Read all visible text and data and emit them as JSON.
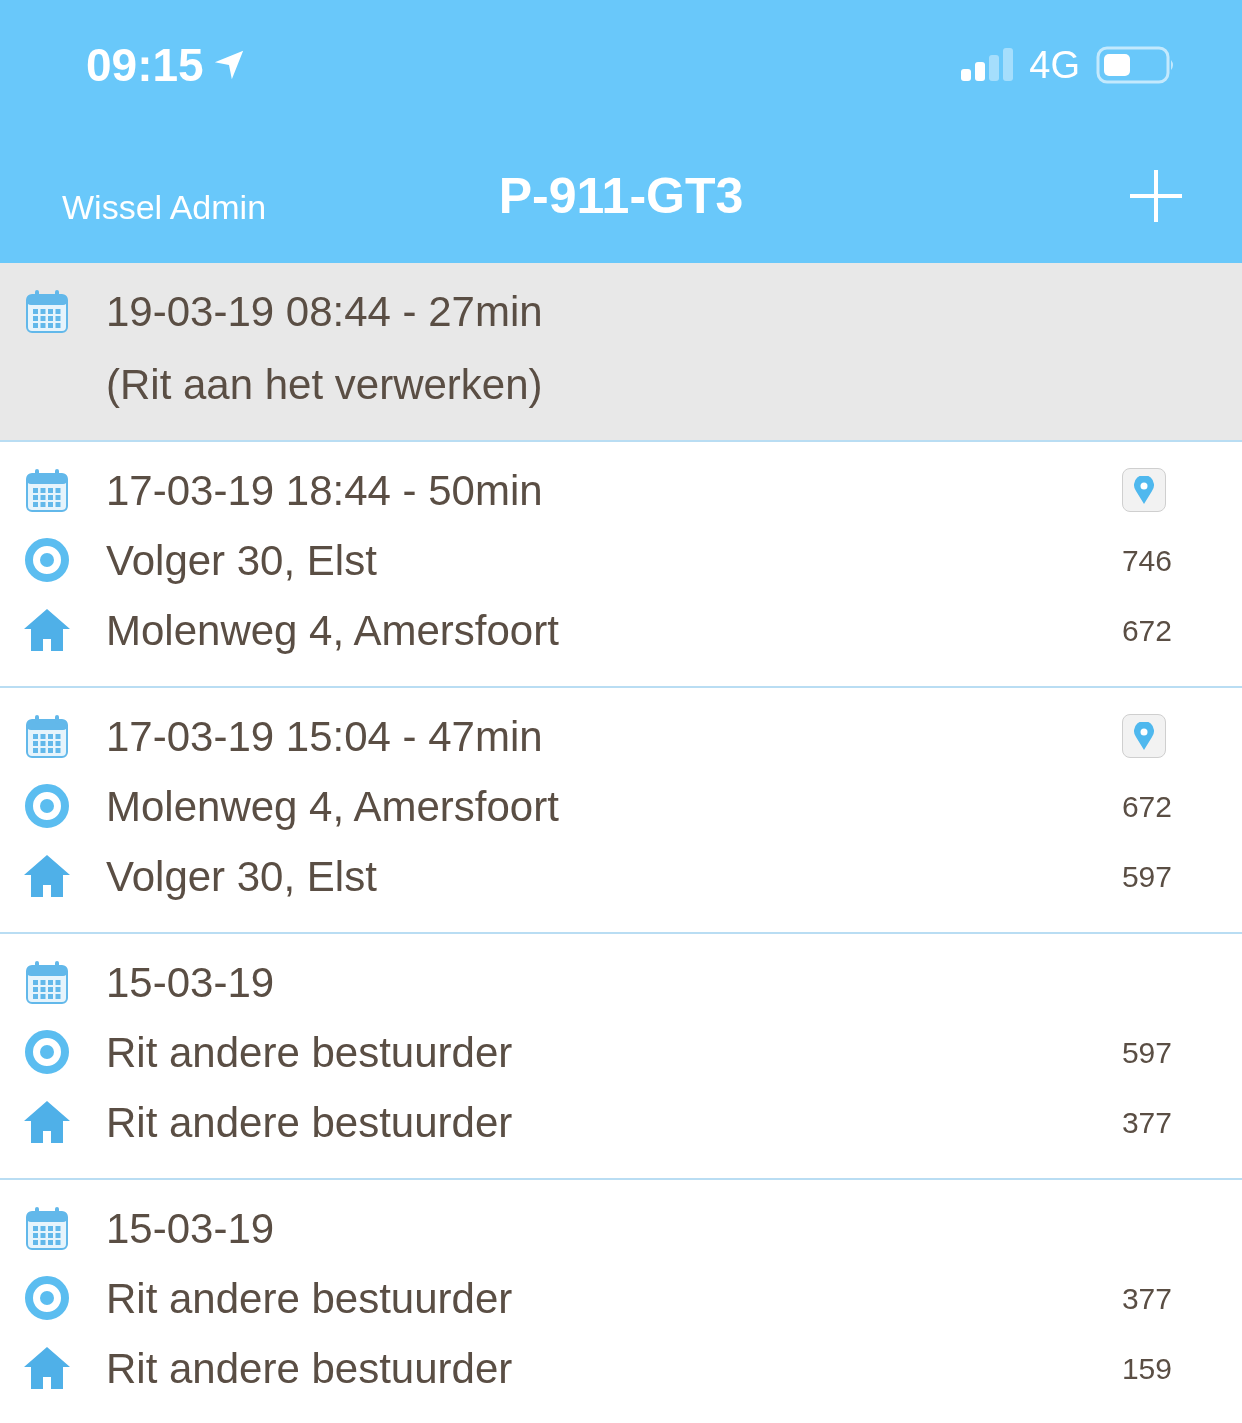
{
  "status_bar": {
    "time": "09:15",
    "network": "4G"
  },
  "nav": {
    "back_label": "Wissel Admin",
    "title": "P-911-GT3"
  },
  "trips": [
    {
      "kind": "processing",
      "date": "19-03-19 08:44 - 27min",
      "status": "(Rit aan het verwerken)"
    },
    {
      "kind": "trip",
      "date": "17-03-19 18:44 - 50min",
      "from": "Volger 30, Elst",
      "from_km": "746",
      "to": "Molenweg 4, Amersfoort",
      "to_km": "672",
      "map": true
    },
    {
      "kind": "trip",
      "date": "17-03-19 15:04 - 47min",
      "from": "Molenweg 4, Amersfoort",
      "from_km": "672",
      "to": "Volger 30, Elst",
      "to_km": "597",
      "map": true
    },
    {
      "kind": "trip",
      "date": "15-03-19",
      "from": "Rit andere bestuurder",
      "from_km": "597",
      "to": "Rit andere bestuurder",
      "to_km": "377",
      "map": false
    },
    {
      "kind": "trip",
      "date": "15-03-19",
      "from": "Rit andere bestuurder",
      "from_km": "377",
      "to": "Rit andere bestuurder",
      "to_km": "159",
      "map": false
    }
  ]
}
